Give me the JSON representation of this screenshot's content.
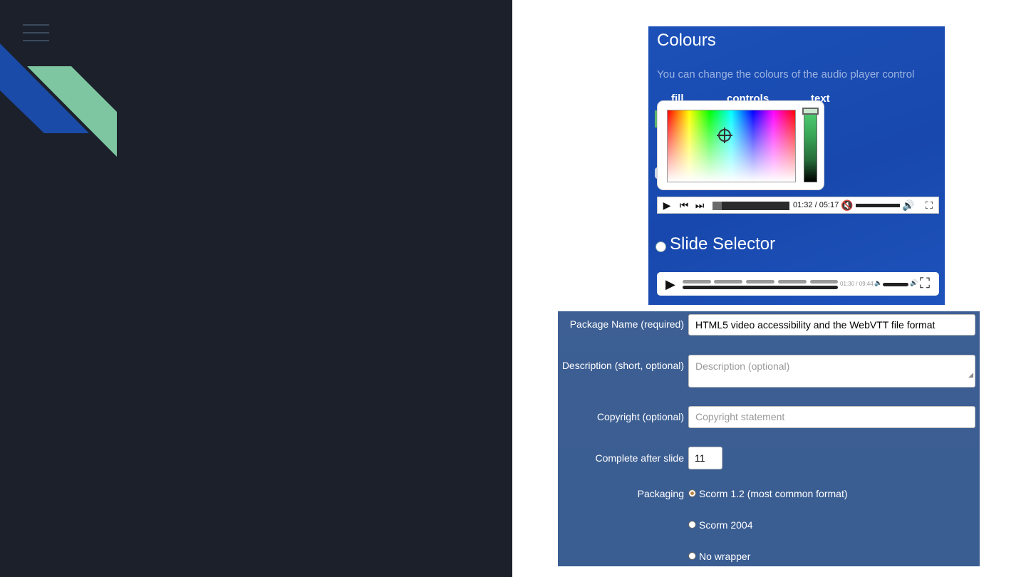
{
  "colours_panel": {
    "title": "Colours",
    "description": "You can change the colours of the audio player control",
    "headers": [
      "fill",
      "controls",
      "text"
    ]
  },
  "audio_player": {
    "time": "01:32 / 05:17",
    "progress": 0.12,
    "volume": 0.95
  },
  "slide_selector": {
    "title": "Slide Selector",
    "time": "01:30 / 09:44",
    "progress": 1.0
  },
  "package_form": {
    "package_name_label": "Package Name (required)",
    "package_name_value": "HTML5 video accessibility and the WebVTT file format",
    "description_label": "Description (short, optional)",
    "description_placeholder": "Description (optional)",
    "copyright_label": "Copyright (optional)",
    "copyright_placeholder": "Copyright statement",
    "complete_label": "Complete after slide",
    "complete_value": "11",
    "packaging_label": "Packaging",
    "packaging_options": [
      {
        "label": "Scorm 1.2 (most common format)",
        "selected": true
      },
      {
        "label": "Scorm 2004",
        "selected": false
      },
      {
        "label": "No wrapper",
        "selected": false
      }
    ]
  },
  "colors": {
    "left_background": "#1b202b",
    "logo_blue": "#1a4ba8",
    "logo_green": "#7ec5a1",
    "colours_panel_bg": "#1c51b8",
    "form_bg": "#3d5f93"
  },
  "icons": [
    "menu-icon",
    "play-icon",
    "previous-icon",
    "next-icon",
    "mute-icon",
    "volume-icon",
    "fullscreen-icon"
  ]
}
